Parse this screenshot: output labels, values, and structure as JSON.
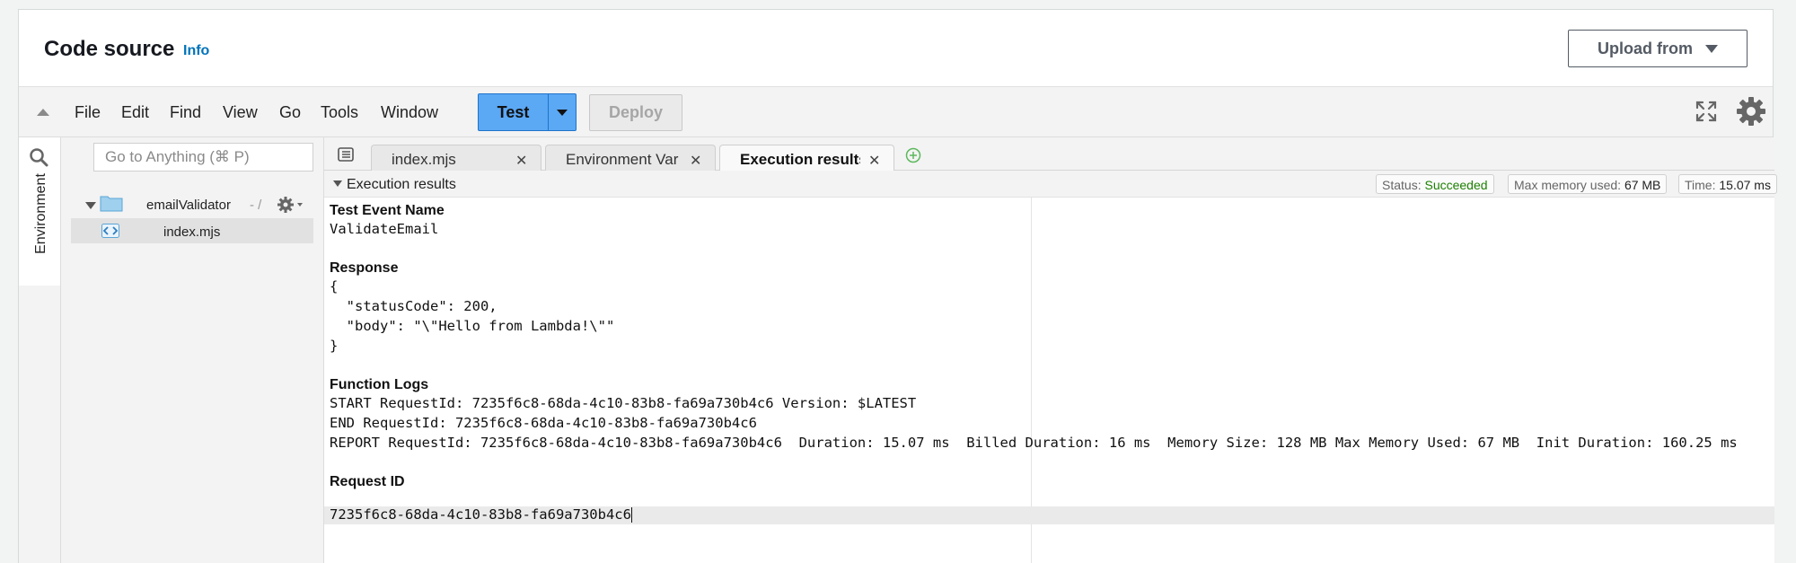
{
  "header": {
    "title": "Code source",
    "info_label": "Info",
    "upload_label": "Upload from"
  },
  "menubar": {
    "items": [
      "File",
      "Edit",
      "Find",
      "View",
      "Go",
      "Tools",
      "Window"
    ],
    "test_label": "Test",
    "deploy_label": "Deploy"
  },
  "sidebar": {
    "environment_label": "Environment",
    "search_placeholder": "Go to Anything (⌘ P)",
    "folder_name": "emailValidator",
    "folder_suffix": "- /",
    "file_name": "index.mjs"
  },
  "tabs": [
    {
      "label": "index.mjs",
      "active": false
    },
    {
      "label": "Environment Var",
      "active": false
    },
    {
      "label": "Execution results",
      "active": true
    }
  ],
  "results": {
    "title": "Execution results",
    "status_label": "Status:",
    "status_value": "Succeeded",
    "memory_label": "Max memory used:",
    "memory_value": "67 MB",
    "time_label": "Time:",
    "time_value": "15.07 ms",
    "test_event_title": "Test Event Name",
    "test_event_value": "ValidateEmail",
    "response_title": "Response",
    "response_lines": [
      "{",
      "  \"statusCode\": 200,",
      "  \"body\": \"\\\"Hello from Lambda!\\\"\"",
      "}"
    ],
    "logs_title": "Function Logs",
    "log_lines": [
      "START RequestId: 7235f6c8-68da-4c10-83b8-fa69a730b4c6 Version: $LATEST",
      "END RequestId: 7235f6c8-68da-4c10-83b8-fa69a730b4c6",
      "REPORT RequestId: 7235f6c8-68da-4c10-83b8-fa69a730b4c6  Duration: 15.07 ms  Billed Duration: 16 ms  Memory Size: 128 MB Max Memory Used: 67 MB  Init Duration: 160.25 ms"
    ],
    "request_id_title": "Request ID",
    "request_id_value": "7235f6c8-68da-4c10-83b8-fa69a730b4c6"
  },
  "colors": {
    "accent": "#5ba8f5",
    "link": "#0073bb",
    "success": "#1d8102"
  }
}
